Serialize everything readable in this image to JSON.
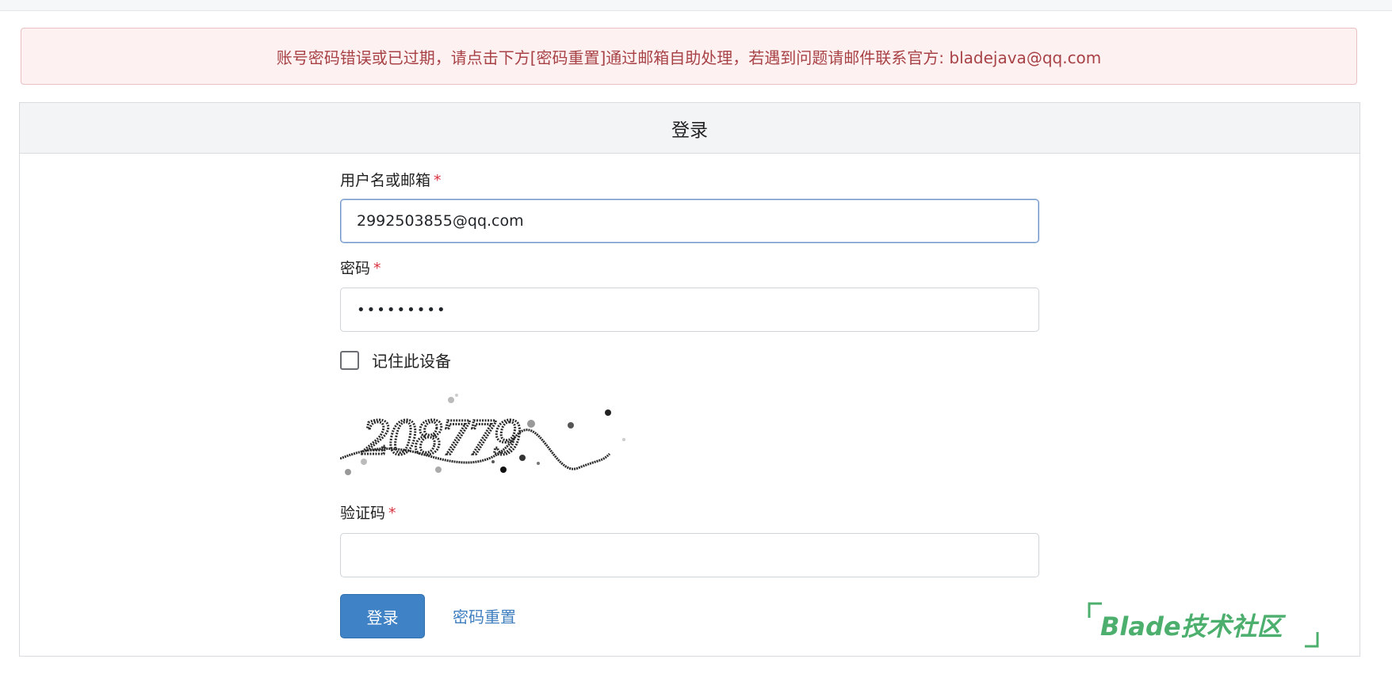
{
  "alert": {
    "message": "账号密码错误或已过期，请点击下方[密码重置]通过邮箱自助处理，若遇到问题请邮件联系官方: bladejava@qq.com"
  },
  "login_card": {
    "title": "登录",
    "username": {
      "label": "用户名或邮箱",
      "required_mark": "*",
      "value": "2992503855@qq.com"
    },
    "password": {
      "label": "密码",
      "required_mark": "*",
      "value": "•••••••••"
    },
    "remember": {
      "label": "记住此设备",
      "checked": false
    },
    "captcha_image": {
      "text": "208779"
    },
    "captcha": {
      "label": "验证码",
      "required_mark": "*",
      "value": ""
    },
    "submit_label": "登录",
    "reset_link": "密码重置"
  },
  "watermark": {
    "text": "Blade技术社区",
    "color": "#4caf6e"
  },
  "colors": {
    "alert_text": "#a84246",
    "alert_bg": "#fdf1f1",
    "primary": "#3f82c5",
    "required": "#d9333f"
  }
}
